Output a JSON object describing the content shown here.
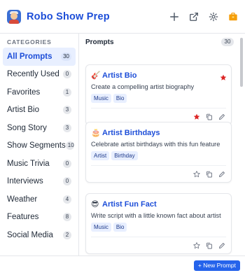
{
  "app": {
    "title": "Robo Show Prep",
    "logo": "robo-avatar-logo",
    "accent_color": "#1d4ed8",
    "header_icons": [
      "plus-icon",
      "external-link-icon",
      "gear-icon",
      "briefcase-icon"
    ]
  },
  "sidebar": {
    "heading": "CATEGORIES",
    "items": [
      {
        "label": "All Prompts",
        "count": "30",
        "active": true
      },
      {
        "label": "Recently Used",
        "count": "0"
      },
      {
        "label": "Favorites",
        "count": "1"
      },
      {
        "label": "Artist Bio",
        "count": "3"
      },
      {
        "label": "Song Story",
        "count": "3"
      },
      {
        "label": "Show Segments",
        "count": "10"
      },
      {
        "label": "Music Trivia",
        "count": "0"
      },
      {
        "label": "Interviews",
        "count": "0"
      },
      {
        "label": "Weather",
        "count": "4"
      },
      {
        "label": "Features",
        "count": "8"
      },
      {
        "label": "Social Media",
        "count": "2"
      }
    ]
  },
  "main": {
    "title": "Prompts",
    "count": "30",
    "cards": [
      {
        "emoji": "🎸",
        "title": "Artist Bio",
        "description": "Create a compelling artist biography",
        "tags": [
          "Music",
          "Bio"
        ],
        "favorite": true
      },
      {
        "emoji": "🎂",
        "title": "Artist Birthdays",
        "description": "Celebrate artist birthdays with this fun feature",
        "tags": [
          "Artist",
          "Birthday"
        ],
        "favorite": false
      },
      {
        "emoji": "😎",
        "title": "Artist Fun Fact",
        "description": "Write script with a little known fact about artist",
        "tags": [
          "Music",
          "Bio"
        ],
        "favorite": false
      }
    ]
  },
  "footer": {
    "new_prompt_label": "+ New Prompt"
  },
  "colors": {
    "favorite_star": "#dc2626",
    "button_bg": "#2563eb"
  }
}
